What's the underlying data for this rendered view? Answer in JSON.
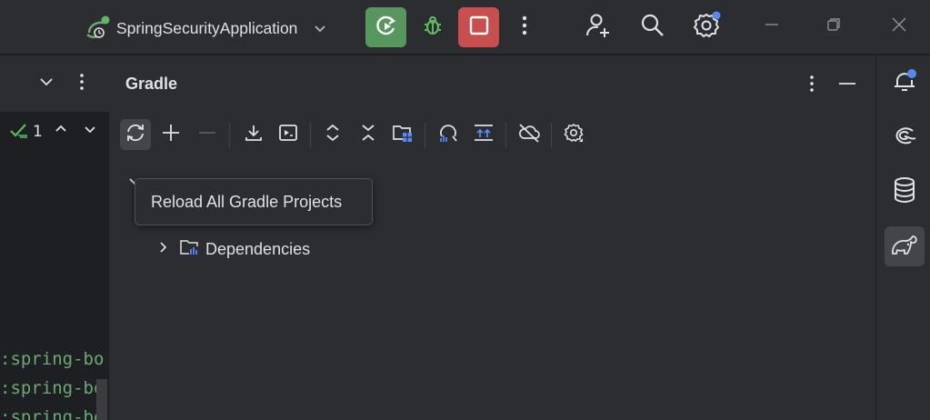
{
  "titlebar": {
    "run_config_label": "SpringSecurityApplication",
    "run_status_color": "#5fb85f",
    "settings_badge_color": "#548af7"
  },
  "editor": {
    "problems_count": "1",
    "code_lines": [
      ":spring-bo",
      ":spring-bo",
      ":spring-bo"
    ]
  },
  "gradle": {
    "title": "Gradle",
    "toolbar": [
      "reload-icon",
      "plus-icon",
      "minus-icon",
      "download-icon",
      "run-task-icon",
      "expand-all-icon",
      "collapse-all-icon",
      "dependency-analyzer-icon",
      "analyze-icon",
      "toggle-offline-icon",
      "cloud-off-icon",
      "gradle-settings-icon"
    ],
    "tooltip": "Reload All Gradle Projects",
    "tree": {
      "dependencies_label": "Dependencies"
    }
  },
  "rightstrip": {
    "items": [
      "notifications-icon",
      "ai-assistant-icon",
      "database-icon",
      "gradle-elephant-icon"
    ],
    "notification_badge_color": "#548af7"
  },
  "colors": {
    "accent_blue": "#548af7",
    "run_green": "#57965c",
    "stop_red": "#c94f4f",
    "code_green": "#6aab73"
  }
}
